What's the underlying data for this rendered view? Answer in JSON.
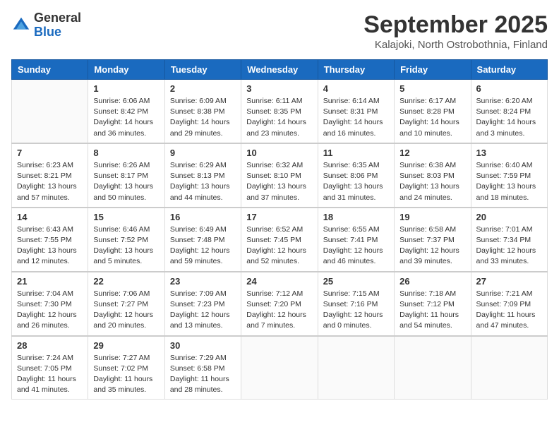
{
  "logo": {
    "general": "General",
    "blue": "Blue"
  },
  "title": "September 2025",
  "subtitle": "Kalajoki, North Ostrobothnia, Finland",
  "days_of_week": [
    "Sunday",
    "Monday",
    "Tuesday",
    "Wednesday",
    "Thursday",
    "Friday",
    "Saturday"
  ],
  "weeks": [
    [
      {
        "day": "",
        "info": ""
      },
      {
        "day": "1",
        "info": "Sunrise: 6:06 AM\nSunset: 8:42 PM\nDaylight: 14 hours\nand 36 minutes."
      },
      {
        "day": "2",
        "info": "Sunrise: 6:09 AM\nSunset: 8:38 PM\nDaylight: 14 hours\nand 29 minutes."
      },
      {
        "day": "3",
        "info": "Sunrise: 6:11 AM\nSunset: 8:35 PM\nDaylight: 14 hours\nand 23 minutes."
      },
      {
        "day": "4",
        "info": "Sunrise: 6:14 AM\nSunset: 8:31 PM\nDaylight: 14 hours\nand 16 minutes."
      },
      {
        "day": "5",
        "info": "Sunrise: 6:17 AM\nSunset: 8:28 PM\nDaylight: 14 hours\nand 10 minutes."
      },
      {
        "day": "6",
        "info": "Sunrise: 6:20 AM\nSunset: 8:24 PM\nDaylight: 14 hours\nand 3 minutes."
      }
    ],
    [
      {
        "day": "7",
        "info": "Sunrise: 6:23 AM\nSunset: 8:21 PM\nDaylight: 13 hours\nand 57 minutes."
      },
      {
        "day": "8",
        "info": "Sunrise: 6:26 AM\nSunset: 8:17 PM\nDaylight: 13 hours\nand 50 minutes."
      },
      {
        "day": "9",
        "info": "Sunrise: 6:29 AM\nSunset: 8:13 PM\nDaylight: 13 hours\nand 44 minutes."
      },
      {
        "day": "10",
        "info": "Sunrise: 6:32 AM\nSunset: 8:10 PM\nDaylight: 13 hours\nand 37 minutes."
      },
      {
        "day": "11",
        "info": "Sunrise: 6:35 AM\nSunset: 8:06 PM\nDaylight: 13 hours\nand 31 minutes."
      },
      {
        "day": "12",
        "info": "Sunrise: 6:38 AM\nSunset: 8:03 PM\nDaylight: 13 hours\nand 24 minutes."
      },
      {
        "day": "13",
        "info": "Sunrise: 6:40 AM\nSunset: 7:59 PM\nDaylight: 13 hours\nand 18 minutes."
      }
    ],
    [
      {
        "day": "14",
        "info": "Sunrise: 6:43 AM\nSunset: 7:55 PM\nDaylight: 13 hours\nand 12 minutes."
      },
      {
        "day": "15",
        "info": "Sunrise: 6:46 AM\nSunset: 7:52 PM\nDaylight: 13 hours\nand 5 minutes."
      },
      {
        "day": "16",
        "info": "Sunrise: 6:49 AM\nSunset: 7:48 PM\nDaylight: 12 hours\nand 59 minutes."
      },
      {
        "day": "17",
        "info": "Sunrise: 6:52 AM\nSunset: 7:45 PM\nDaylight: 12 hours\nand 52 minutes."
      },
      {
        "day": "18",
        "info": "Sunrise: 6:55 AM\nSunset: 7:41 PM\nDaylight: 12 hours\nand 46 minutes."
      },
      {
        "day": "19",
        "info": "Sunrise: 6:58 AM\nSunset: 7:37 PM\nDaylight: 12 hours\nand 39 minutes."
      },
      {
        "day": "20",
        "info": "Sunrise: 7:01 AM\nSunset: 7:34 PM\nDaylight: 12 hours\nand 33 minutes."
      }
    ],
    [
      {
        "day": "21",
        "info": "Sunrise: 7:04 AM\nSunset: 7:30 PM\nDaylight: 12 hours\nand 26 minutes."
      },
      {
        "day": "22",
        "info": "Sunrise: 7:06 AM\nSunset: 7:27 PM\nDaylight: 12 hours\nand 20 minutes."
      },
      {
        "day": "23",
        "info": "Sunrise: 7:09 AM\nSunset: 7:23 PM\nDaylight: 12 hours\nand 13 minutes."
      },
      {
        "day": "24",
        "info": "Sunrise: 7:12 AM\nSunset: 7:20 PM\nDaylight: 12 hours\nand 7 minutes."
      },
      {
        "day": "25",
        "info": "Sunrise: 7:15 AM\nSunset: 7:16 PM\nDaylight: 12 hours\nand 0 minutes."
      },
      {
        "day": "26",
        "info": "Sunrise: 7:18 AM\nSunset: 7:12 PM\nDaylight: 11 hours\nand 54 minutes."
      },
      {
        "day": "27",
        "info": "Sunrise: 7:21 AM\nSunset: 7:09 PM\nDaylight: 11 hours\nand 47 minutes."
      }
    ],
    [
      {
        "day": "28",
        "info": "Sunrise: 7:24 AM\nSunset: 7:05 PM\nDaylight: 11 hours\nand 41 minutes."
      },
      {
        "day": "29",
        "info": "Sunrise: 7:27 AM\nSunset: 7:02 PM\nDaylight: 11 hours\nand 35 minutes."
      },
      {
        "day": "30",
        "info": "Sunrise: 7:29 AM\nSunset: 6:58 PM\nDaylight: 11 hours\nand 28 minutes."
      },
      {
        "day": "",
        "info": ""
      },
      {
        "day": "",
        "info": ""
      },
      {
        "day": "",
        "info": ""
      },
      {
        "day": "",
        "info": ""
      }
    ]
  ]
}
